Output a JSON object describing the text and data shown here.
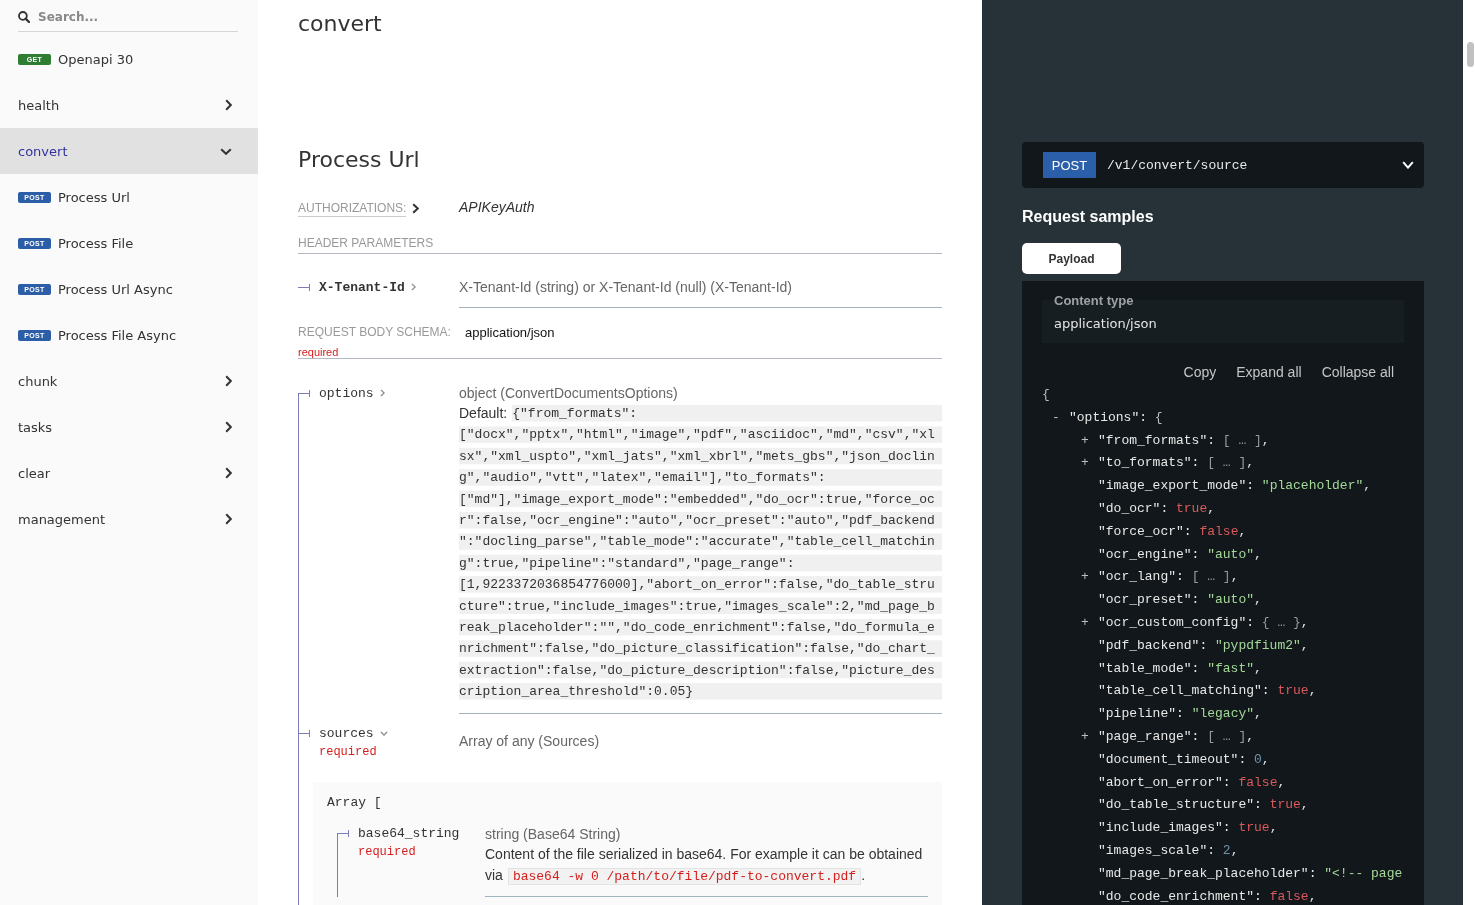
{
  "sidebar": {
    "search": {
      "placeholder": "Search..."
    },
    "items": [
      {
        "kind": "operation",
        "method": "GET",
        "color": "#2e7d32",
        "label": "Openapi 30",
        "selected": false
      },
      {
        "kind": "group",
        "label": "health",
        "selected": false,
        "expanded": false
      },
      {
        "kind": "group",
        "label": "convert",
        "selected": true,
        "expanded": true,
        "children": [
          {
            "kind": "operation",
            "method": "POST",
            "color": "#2b5ea6",
            "label": "Process Url",
            "selected": false
          },
          {
            "kind": "operation",
            "method": "POST",
            "color": "#2b5ea6",
            "label": "Process File",
            "selected": false
          },
          {
            "kind": "operation",
            "method": "POST",
            "color": "#2b5ea6",
            "label": "Process Url Async",
            "selected": false
          },
          {
            "kind": "operation",
            "method": "POST",
            "color": "#2b5ea6",
            "label": "Process File Async",
            "selected": false
          }
        ]
      },
      {
        "kind": "group",
        "label": "chunk",
        "selected": false,
        "expanded": false
      },
      {
        "kind": "group",
        "label": "tasks",
        "selected": false,
        "expanded": false
      },
      {
        "kind": "group",
        "label": "clear",
        "selected": false,
        "expanded": false
      },
      {
        "kind": "group",
        "label": "management",
        "selected": false,
        "expanded": false
      }
    ]
  },
  "content": {
    "tag_title": "convert",
    "operation": {
      "title": "Process Url",
      "authorizations": {
        "label": "AUTHORIZATIONS:",
        "expanded": false,
        "value": "APIKeyAuth"
      },
      "header_parameters": {
        "title": "HEADER PARAMETERS",
        "params": [
          {
            "name": "X-Tenant-Id",
            "expanded": false,
            "type": "X-Tenant-Id (string) or X-Tenant-Id (null) (X-Tenant-Id)"
          }
        ]
      },
      "request_body": {
        "label": "REQUEST BODY SCHEMA:",
        "content_type": "application/json",
        "required": "required",
        "properties": [
          {
            "name": "options",
            "expanded": false,
            "type": "object (ConvertDocumentsOptions)",
            "default_label": "Default:",
            "default": "{\"from_formats\":[\"docx\",\"pptx\",\"html\",\"image\",\"pdf\",\"asciidoc\",\"md\",\"csv\",\"xlsx\",\"xml_uspto\",\"xml_jats\",\"xml_xbrl\",\"mets_gbs\",\"json_docling\",\"audio\",\"vtt\",\"latex\",\"email\"],\"to_formats\":[\"md\"],\"image_export_mode\":\"embedded\",\"do_ocr\":true,\"force_ocr\":false,\"ocr_engine\":\"auto\",\"ocr_preset\":\"auto\",\"pdf_backend\":\"docling_parse\",\"table_mode\":\"accurate\",\"table_cell_matching\":true,\"pipeline\":\"standard\",\"page_range\":[1,9223372036854776000],\"abort_on_error\":false,\"do_table_structure\":true,\"include_images\":true,\"images_scale\":2,\"md_page_break_placeholder\":\"\",\"do_code_enrichment\":false,\"do_formula_enrichment\":false,\"do_picture_classification\":false,\"do_chart_extraction\":false,\"do_picture_description\":false,\"picture_description_area_threshold\":0.05}"
          },
          {
            "name": "sources",
            "required": "required",
            "expanded": true,
            "type": "Array of any (Sources)",
            "array": {
              "open": "Array [",
              "items": [
                {
                  "name": "base64_string",
                  "required": "required",
                  "type": "string (Base64 String)",
                  "description": {
                    "text": "Content of the file serialized in base64. For example it can be obtained via",
                    "code": "base64 -w 0 /path/to/file/pdf-to-convert.pdf",
                    "end": "."
                  }
                }
              ]
            }
          }
        ]
      }
    }
  },
  "request_samples": {
    "endpoint": {
      "method": "POST",
      "path": "/v1/convert/source"
    },
    "title": "Request samples",
    "tabs": [
      {
        "label": "Payload",
        "selected": true
      }
    ],
    "content_type": {
      "label": "Content type",
      "value": "application/json"
    },
    "actions": [
      "Copy",
      "Expand all",
      "Collapse all"
    ],
    "code": {
      "open": "{",
      "entries": [
        {
          "toggle": "-",
          "key": "\"options\":",
          "kind": "object",
          "value": "{",
          "children": [
            {
              "toggle": "+",
              "key": "\"from_formats\":",
              "kind": "collapsed",
              "value": "[ … ]",
              "end": ","
            },
            {
              "toggle": "+",
              "key": "\"to_formats\":",
              "kind": "collapsed",
              "value": "[ … ]",
              "end": ","
            },
            {
              "key": "\"image_export_mode\":",
              "kind": "string",
              "value": "\"placeholder\"",
              "end": ","
            },
            {
              "key": "\"do_ocr\":",
              "kind": "boolean",
              "value": "true",
              "end": ","
            },
            {
              "key": "\"force_ocr\":",
              "kind": "boolean",
              "value": "false",
              "end": ","
            },
            {
              "key": "\"ocr_engine\":",
              "kind": "string",
              "value": "\"auto\"",
              "end": ","
            },
            {
              "toggle": "+",
              "key": "\"ocr_lang\":",
              "kind": "collapsed",
              "value": "[ … ]",
              "end": ","
            },
            {
              "key": "\"ocr_preset\":",
              "kind": "string",
              "value": "\"auto\"",
              "end": ","
            },
            {
              "toggle": "+",
              "key": "\"ocr_custom_config\":",
              "kind": "collapsed",
              "value": "{ … }",
              "end": ","
            },
            {
              "key": "\"pdf_backend\":",
              "kind": "string",
              "value": "\"pypdfium2\"",
              "end": ","
            },
            {
              "key": "\"table_mode\":",
              "kind": "string",
              "value": "\"fast\"",
              "end": ","
            },
            {
              "key": "\"table_cell_matching\":",
              "kind": "boolean",
              "value": "true",
              "end": ","
            },
            {
              "key": "\"pipeline\":",
              "kind": "string",
              "value": "\"legacy\"",
              "end": ","
            },
            {
              "toggle": "+",
              "key": "\"page_range\":",
              "kind": "collapsed",
              "value": "[ … ]",
              "end": ","
            },
            {
              "key": "\"document_timeout\":",
              "kind": "number",
              "value": "0",
              "end": ","
            },
            {
              "key": "\"abort_on_error\":",
              "kind": "boolean",
              "value": "false",
              "end": ","
            },
            {
              "key": "\"do_table_structure\":",
              "kind": "boolean",
              "value": "true",
              "end": ","
            },
            {
              "key": "\"include_images\":",
              "kind": "boolean",
              "value": "true",
              "end": ","
            },
            {
              "key": "\"images_scale\":",
              "kind": "number",
              "value": "2",
              "end": ","
            },
            {
              "key": "\"md_page_break_placeholder\":",
              "kind": "string",
              "value": "\"<!-- page"
            },
            {
              "key": "\"do_code_enrichment\":",
              "kind": "boolean",
              "value": "false",
              "end": ","
            }
          ]
        }
      ]
    }
  }
}
